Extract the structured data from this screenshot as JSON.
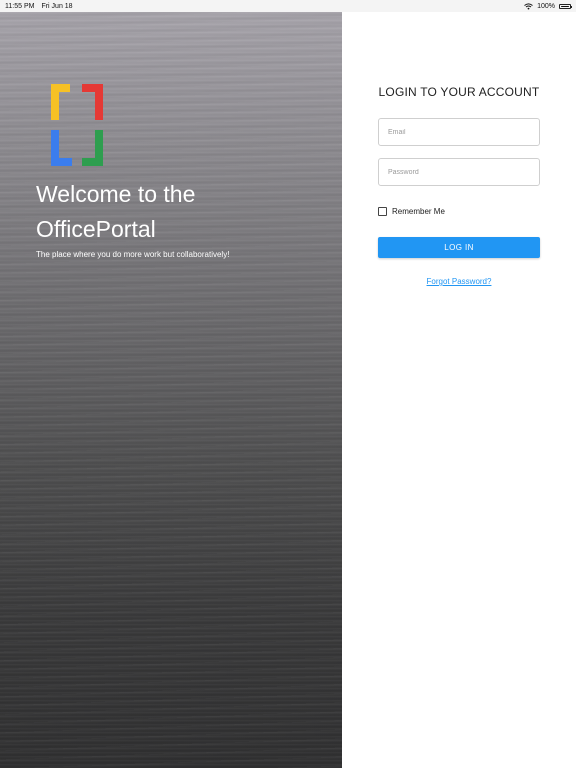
{
  "status_bar": {
    "time": "11:55 PM",
    "date": "Fri Jun 18",
    "battery": "100%",
    "icons": [
      "wifi-icon",
      "battery-icon"
    ]
  },
  "hero": {
    "welcome_line1": "Welcome to the",
    "welcome_line2": "OfficePortal",
    "tagline": "The place where you do more work but collaboratively!",
    "logo": {
      "icon": "brackets-logo",
      "colors": [
        "#f6c125",
        "#e53935",
        "#3b7ded",
        "#2e9e4f"
      ]
    }
  },
  "login": {
    "title": "LOGIN TO YOUR ACCOUNT",
    "email_placeholder": "Email",
    "password_placeholder": "Password",
    "remember_label": "Remember Me",
    "login_button": "LOG IN",
    "forgot_link": "Forgot Password?"
  },
  "colors": {
    "accent": "#2196f3",
    "panel_bg": "#ffffff"
  }
}
